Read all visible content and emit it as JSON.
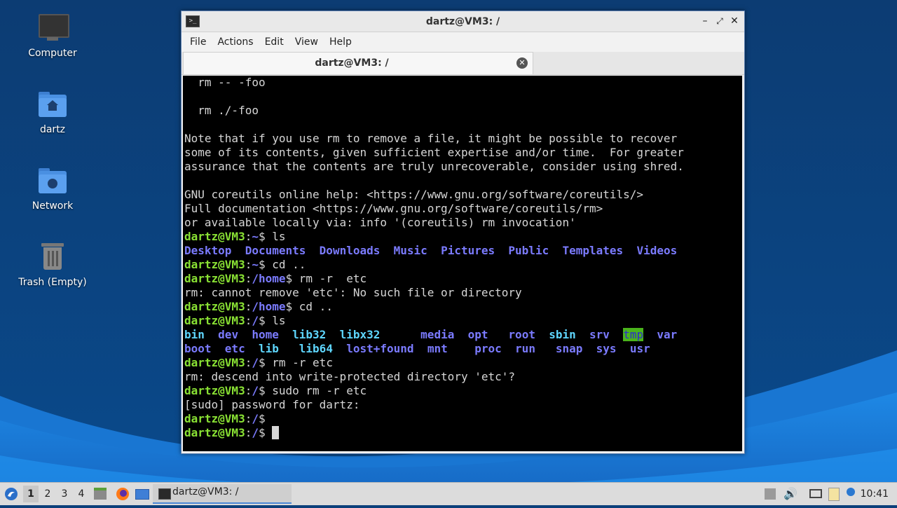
{
  "desktop": {
    "icons": [
      {
        "label": "Computer",
        "icon": "computer-icon"
      },
      {
        "label": "dartz",
        "icon": "home-folder-icon"
      },
      {
        "label": "Network",
        "icon": "network-folder-icon"
      },
      {
        "label": "Trash (Empty)",
        "icon": "trash-icon"
      }
    ]
  },
  "window": {
    "title": "dartz@VM3: /",
    "menu": [
      "File",
      "Actions",
      "Edit",
      "View",
      "Help"
    ],
    "tab_label": "dartz@VM3: /"
  },
  "terminal": {
    "lines": [
      [
        {
          "t": "  rm -- -foo"
        }
      ],
      [
        {
          "t": ""
        }
      ],
      [
        {
          "t": "  rm ./-foo"
        }
      ],
      [
        {
          "t": ""
        }
      ],
      [
        {
          "t": "Note that if you use rm to remove a file, it might be possible to recover"
        }
      ],
      [
        {
          "t": "some of its contents, given sufficient expertise and/or time.  For greater"
        }
      ],
      [
        {
          "t": "assurance that the contents are truly unrecoverable, consider using shred."
        }
      ],
      [
        {
          "t": ""
        }
      ],
      [
        {
          "t": "GNU coreutils online help: <https://www.gnu.org/software/coreutils/>"
        }
      ],
      [
        {
          "t": "Full documentation <https://www.gnu.org/software/coreutils/rm>"
        }
      ],
      [
        {
          "t": "or available locally via: info '(coreutils) rm invocation'"
        }
      ],
      [
        {
          "t": "dartz@VM3",
          "c": "g"
        },
        {
          "t": ":"
        },
        {
          "t": "~",
          "c": "b"
        },
        {
          "t": "$ ls"
        }
      ],
      [
        {
          "t": "Desktop",
          "c": "b"
        },
        {
          "t": "  "
        },
        {
          "t": "Documents",
          "c": "b"
        },
        {
          "t": "  "
        },
        {
          "t": "Downloads",
          "c": "b"
        },
        {
          "t": "  "
        },
        {
          "t": "Music",
          "c": "b"
        },
        {
          "t": "  "
        },
        {
          "t": "Pictures",
          "c": "b"
        },
        {
          "t": "  "
        },
        {
          "t": "Public",
          "c": "b"
        },
        {
          "t": "  "
        },
        {
          "t": "Templates",
          "c": "b"
        },
        {
          "t": "  "
        },
        {
          "t": "Videos",
          "c": "b"
        }
      ],
      [
        {
          "t": "dartz@VM3",
          "c": "g"
        },
        {
          "t": ":"
        },
        {
          "t": "~",
          "c": "b"
        },
        {
          "t": "$ cd .."
        }
      ],
      [
        {
          "t": "dartz@VM3",
          "c": "g"
        },
        {
          "t": ":"
        },
        {
          "t": "/home",
          "c": "b"
        },
        {
          "t": "$ rm -r  etc"
        }
      ],
      [
        {
          "t": "rm: cannot remove 'etc': No such file or directory"
        }
      ],
      [
        {
          "t": "dartz@VM3",
          "c": "g"
        },
        {
          "t": ":"
        },
        {
          "t": "/home",
          "c": "b"
        },
        {
          "t": "$ cd .."
        }
      ],
      [
        {
          "t": "dartz@VM3",
          "c": "g"
        },
        {
          "t": ":"
        },
        {
          "t": "/",
          "c": "b"
        },
        {
          "t": "$ ls"
        }
      ],
      [
        {
          "t": "bin",
          "c": "c"
        },
        {
          "t": "  "
        },
        {
          "t": "dev",
          "c": "b"
        },
        {
          "t": "  "
        },
        {
          "t": "home",
          "c": "b"
        },
        {
          "t": "  "
        },
        {
          "t": "lib32",
          "c": "c"
        },
        {
          "t": "  "
        },
        {
          "t": "libx32",
          "c": "c"
        },
        {
          "t": "      "
        },
        {
          "t": "media",
          "c": "b"
        },
        {
          "t": "  "
        },
        {
          "t": "opt",
          "c": "b"
        },
        {
          "t": "   "
        },
        {
          "t": "root",
          "c": "b"
        },
        {
          "t": "  "
        },
        {
          "t": "sbin",
          "c": "c"
        },
        {
          "t": "  "
        },
        {
          "t": "srv",
          "c": "b"
        },
        {
          "t": "  "
        },
        {
          "t": "tmp",
          "c": "hl"
        },
        {
          "t": "  "
        },
        {
          "t": "var",
          "c": "b"
        }
      ],
      [
        {
          "t": "boot",
          "c": "b"
        },
        {
          "t": "  "
        },
        {
          "t": "etc",
          "c": "b"
        },
        {
          "t": "  "
        },
        {
          "t": "lib",
          "c": "c"
        },
        {
          "t": "   "
        },
        {
          "t": "lib64",
          "c": "c"
        },
        {
          "t": "  "
        },
        {
          "t": "lost+found",
          "c": "b"
        },
        {
          "t": "  "
        },
        {
          "t": "mnt",
          "c": "b"
        },
        {
          "t": "    "
        },
        {
          "t": "proc",
          "c": "b"
        },
        {
          "t": "  "
        },
        {
          "t": "run",
          "c": "b"
        },
        {
          "t": "   "
        },
        {
          "t": "snap",
          "c": "b"
        },
        {
          "t": "  "
        },
        {
          "t": "sys",
          "c": "b"
        },
        {
          "t": "  "
        },
        {
          "t": "usr",
          "c": "b"
        }
      ],
      [
        {
          "t": "dartz@VM3",
          "c": "g"
        },
        {
          "t": ":"
        },
        {
          "t": "/",
          "c": "b"
        },
        {
          "t": "$ rm -r etc"
        }
      ],
      [
        {
          "t": "rm: descend into write-protected directory 'etc'?"
        }
      ],
      [
        {
          "t": "dartz@VM3",
          "c": "g"
        },
        {
          "t": ":"
        },
        {
          "t": "/",
          "c": "b"
        },
        {
          "t": "$ sudo rm -r etc"
        }
      ],
      [
        {
          "t": "[sudo] password for dartz:"
        }
      ],
      [
        {
          "t": "dartz@VM3",
          "c": "g"
        },
        {
          "t": ":"
        },
        {
          "t": "/",
          "c": "b"
        },
        {
          "t": "$"
        }
      ],
      [
        {
          "t": "dartz@VM3",
          "c": "g"
        },
        {
          "t": ":"
        },
        {
          "t": "/",
          "c": "b"
        },
        {
          "t": "$ "
        },
        {
          "t": " ",
          "c": "cursor"
        }
      ]
    ]
  },
  "taskbar": {
    "workspaces": [
      "1",
      "2",
      "3",
      "4"
    ],
    "active_workspace": "1",
    "task_label": "dartz@VM3: /",
    "clock": "10:41"
  }
}
